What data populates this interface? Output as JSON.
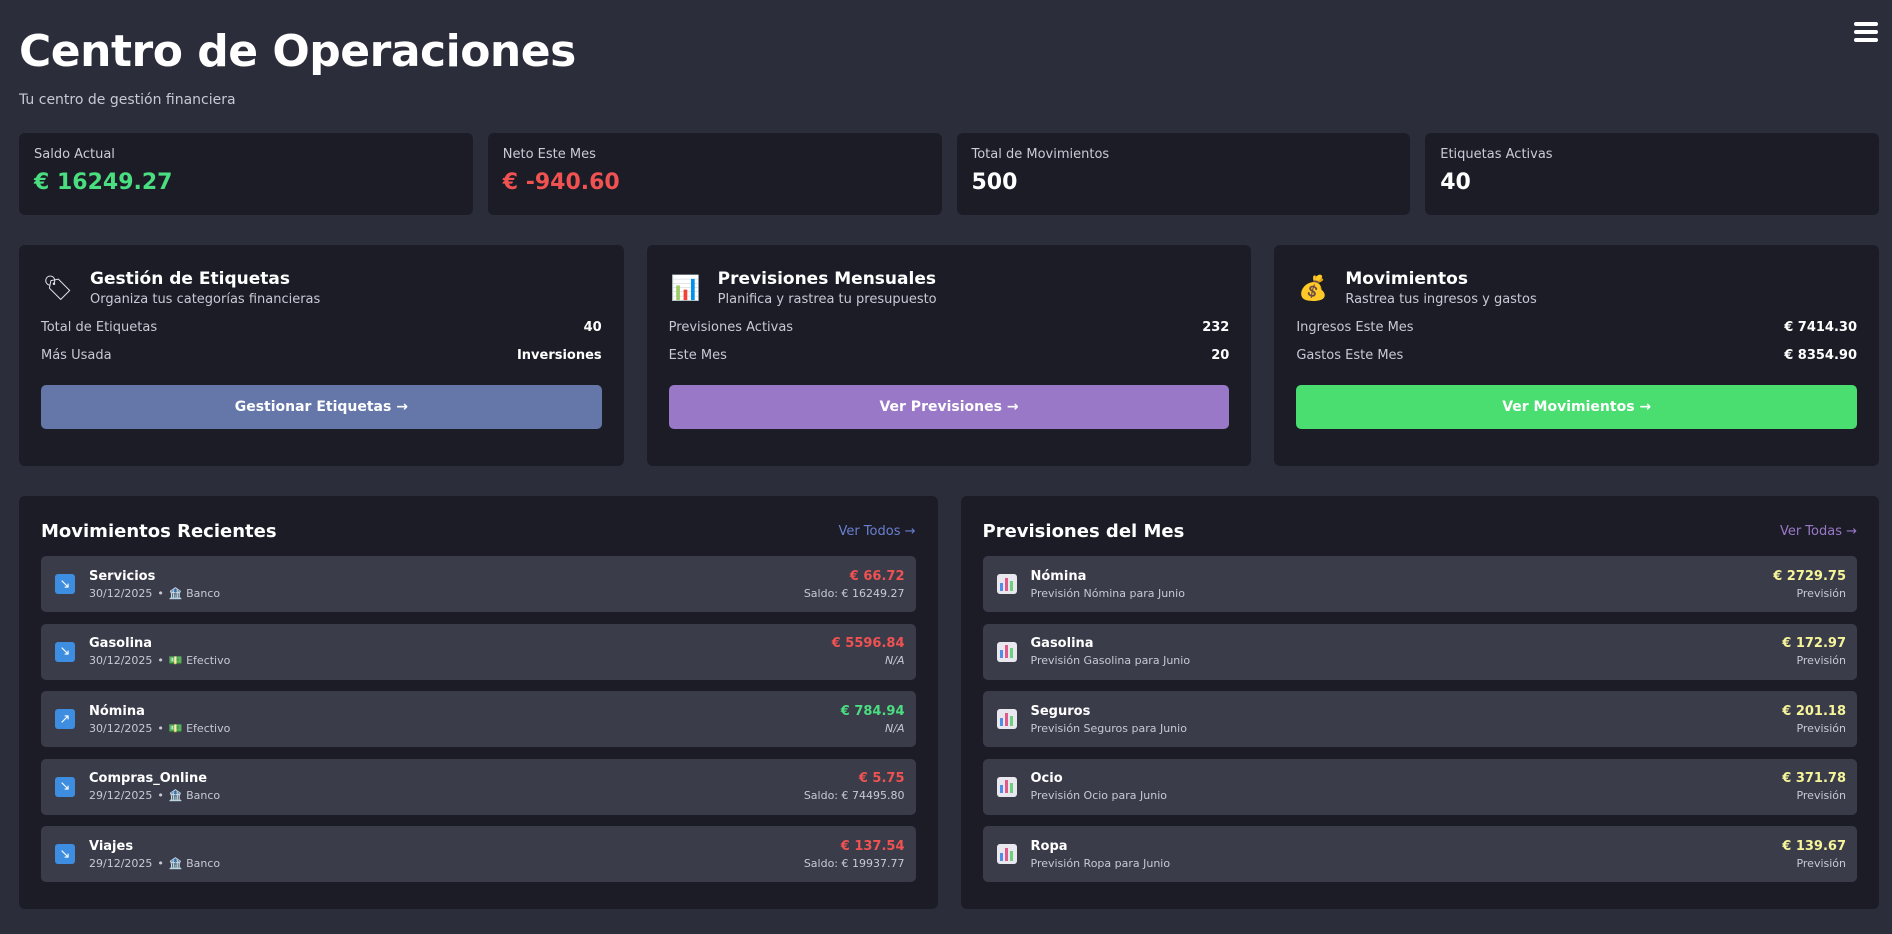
{
  "header": {
    "title": "Centro de Operaciones",
    "subtitle": "Tu centro de gestión financiera"
  },
  "stats": [
    {
      "label": "Saldo Actual",
      "value": "€ 16249.27",
      "color": "#4ade80"
    },
    {
      "label": "Neto Este Mes",
      "value": "€ -940.60",
      "color": "#f05252"
    },
    {
      "label": "Total de Movimientos",
      "value": "500",
      "color": "#ffffff"
    },
    {
      "label": "Etiquetas Activas",
      "value": "40",
      "color": "#ffffff"
    }
  ],
  "cards": [
    {
      "icon": "tag-icon",
      "glyph": "🏷",
      "title": "Gestión de Etiquetas",
      "subtitle": "Organiza tus categorías financieras",
      "rows": [
        {
          "k": "Total de Etiquetas",
          "v": "40"
        },
        {
          "k": "Más Usada",
          "v": "Inversiones"
        }
      ],
      "button": "Gestionar Etiquetas →",
      "button_color": "#6577a8"
    },
    {
      "icon": "bar-chart-icon",
      "glyph": "📊",
      "title": "Previsiones Mensuales",
      "subtitle": "Planifica y rastrea tu presupuesto",
      "rows": [
        {
          "k": "Previsiones Activas",
          "v": "232"
        },
        {
          "k": "Este Mes",
          "v": "20"
        }
      ],
      "button": "Ver Previsiones →",
      "button_color": "#9a78c8"
    },
    {
      "icon": "money-bag-icon",
      "glyph": "💰",
      "title": "Movimientos",
      "subtitle": "Rastrea tus ingresos y gastos",
      "rows": [
        {
          "k": "Ingresos Este Mes",
          "v": "€ 7414.30"
        },
        {
          "k": "Gastos Este Mes",
          "v": "€ 8354.90"
        }
      ],
      "button": "Ver Movimientos →",
      "button_color": "#4ade70"
    }
  ],
  "recent": {
    "title": "Movimientos Recientes",
    "link": "Ver Todos →",
    "link_color": "#6b7fd1",
    "items": [
      {
        "name": "Servicios",
        "date": "30/12/2025",
        "account_icon": "🏦",
        "account": "Banco",
        "amount": "€ 66.72",
        "direction": "down",
        "color": "#f05252",
        "note": "Saldo: € 16249.27"
      },
      {
        "name": "Gasolina",
        "date": "30/12/2025",
        "account_icon": "💵",
        "account": "Efectivo",
        "amount": "€ 5596.84",
        "direction": "down",
        "color": "#f05252",
        "note": "N/A"
      },
      {
        "name": "Nómina",
        "date": "30/12/2025",
        "account_icon": "💵",
        "account": "Efectivo",
        "amount": "€ 784.94",
        "direction": "up",
        "color": "#4ade80",
        "note": "N/A"
      },
      {
        "name": "Compras_Online",
        "date": "29/12/2025",
        "account_icon": "🏦",
        "account": "Banco",
        "amount": "€ 5.75",
        "direction": "down",
        "color": "#f05252",
        "note": "Saldo: € 74495.80"
      },
      {
        "name": "Viajes",
        "date": "29/12/2025",
        "account_icon": "🏦",
        "account": "Banco",
        "amount": "€ 137.54",
        "direction": "down",
        "color": "#f05252",
        "note": "Saldo: € 19937.77"
      }
    ]
  },
  "forecasts": {
    "title": "Previsiones del Mes",
    "link": "Ver Todas →",
    "link_color": "#9a78c8",
    "amount_color": "#f6f59a",
    "items": [
      {
        "name": "Nómina",
        "desc": "Previsión Nómina para Junio",
        "amount": "€ 2729.75",
        "note": "Previsión"
      },
      {
        "name": "Gasolina",
        "desc": "Previsión Gasolina para Junio",
        "amount": "€ 172.97",
        "note": "Previsión"
      },
      {
        "name": "Seguros",
        "desc": "Previsión Seguros para Junio",
        "amount": "€ 201.18",
        "note": "Previsión"
      },
      {
        "name": "Ocio",
        "desc": "Previsión Ocio para Junio",
        "amount": "€ 371.78",
        "note": "Previsión"
      },
      {
        "name": "Ropa",
        "desc": "Previsión Ropa para Junio",
        "amount": "€ 139.67",
        "note": "Previsión"
      }
    ]
  }
}
